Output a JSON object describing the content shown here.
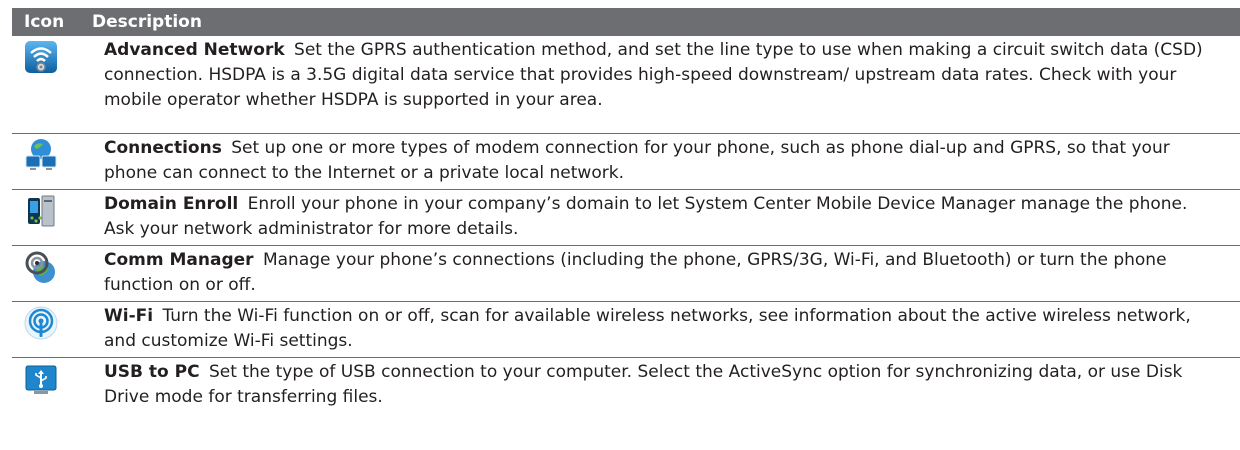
{
  "header": {
    "icon_col": "Icon",
    "desc_col": "Description"
  },
  "rows": [
    {
      "icon": "advanced-network-icon",
      "title": "Advanced Network",
      "text": "Set the GPRS authentication method, and set the line type to use when making a circuit switch data (CSD) connection. HSDPA is a 3.5G digital data service that provides high-speed downstream/ upstream data rates. Check with your mobile operator whether HSDPA is supported in your area."
    },
    {
      "icon": "connections-icon",
      "title": "Connections",
      "text": "Set up one or more types of modem connection for your phone, such as phone dial-up and GPRS, so that your phone can connect to the Internet or a private local network."
    },
    {
      "icon": "domain-enroll-icon",
      "title": "Domain Enroll",
      "text": "Enroll your phone in your company’s domain to let System Center Mobile Device Manager manage the phone. Ask your network administrator for more details."
    },
    {
      "icon": "comm-manager-icon",
      "title": "Comm Manager",
      "text": "Manage your phone’s connections (including the phone, GPRS/3G, Wi-Fi, and Bluetooth) or turn the phone function on or off."
    },
    {
      "icon": "wifi-icon",
      "title": "Wi-Fi",
      "text": "Turn the Wi-Fi function on or off, scan for available wireless networks, see information about the active wireless network, and customize Wi-Fi settings."
    },
    {
      "icon": "usb-to-pc-icon",
      "title": "USB to PC",
      "text": "Set the type of USB connection to your computer. Select the ActiveSync option for synchronizing data, or use Disk Drive mode for transferring files."
    }
  ],
  "colors": {
    "header_bg": "#6d6e71",
    "header_text": "#ffffff",
    "rule": "#6d6e71",
    "icon_blue": "#1e7fc1"
  }
}
